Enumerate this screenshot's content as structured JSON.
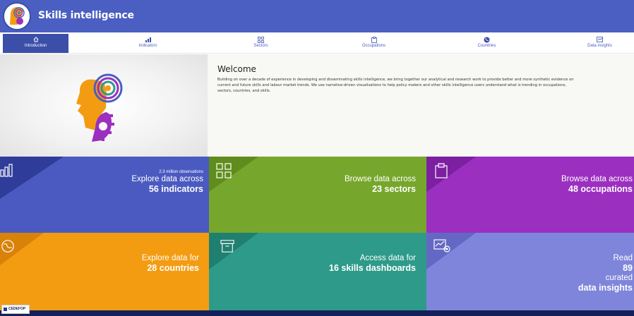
{
  "header": {
    "title": "Skills intelligence"
  },
  "nav": [
    {
      "label": "Introduction",
      "icon": "home-icon",
      "active": true
    },
    {
      "label": "Indicators",
      "icon": "bar-chart-icon"
    },
    {
      "label": "Sectors",
      "icon": "grid-icon"
    },
    {
      "label": "Occupations",
      "icon": "clipboard-icon"
    },
    {
      "label": "Countries",
      "icon": "globe-icon"
    },
    {
      "label": "Data insights",
      "icon": "insights-icon"
    }
  ],
  "welcome": {
    "title": "Welcome",
    "body": "Building on over a decade of experience in developing and disseminating skills intelligence, we bring together our analytical and research work to provide better and more synthetic evidence on current and future skills and labour market trends. We use narrative-driven visualisations to help policy makers and other skills intelligence users understand what is trending in occupations, sectors, countries, and skills."
  },
  "tiles": [
    {
      "small": "2.3 million observations",
      "line1": "Explore data across",
      "line2": "56 indicators",
      "icon": "bar-chart-icon",
      "color": "#4a5ac0",
      "tri": "#2f3c9a"
    },
    {
      "small": "",
      "line1": "Browse data across",
      "line2": "23 sectors",
      "icon": "grid-icon",
      "color": "#76a72c",
      "tri": "#5f8c1c"
    },
    {
      "small": "",
      "line1": "Browse data across",
      "line2": "48 occupations",
      "icon": "clipboard-icon",
      "color": "#9b2fc0",
      "tri": "#7c1fa0"
    },
    {
      "small": "",
      "line1": "Explore data for",
      "line2": "28 countries",
      "icon": "globe-icon",
      "color": "#f39c12",
      "tri": "#d9820a"
    },
    {
      "small": "",
      "line1": "Access data for",
      "line2": "16 skills dashboards",
      "icon": "archive-icon",
      "color": "#2e9a8a",
      "tri": "#1f7f70"
    },
    {
      "small": "",
      "line1": "Read",
      "line2a": "89",
      "line2b": "curated",
      "line2": "data insights",
      "icon": "insights-icon",
      "color": "#7f85da",
      "tri": "#6468c4"
    }
  ],
  "footer": {
    "logo_text": "CEDEFOP"
  }
}
